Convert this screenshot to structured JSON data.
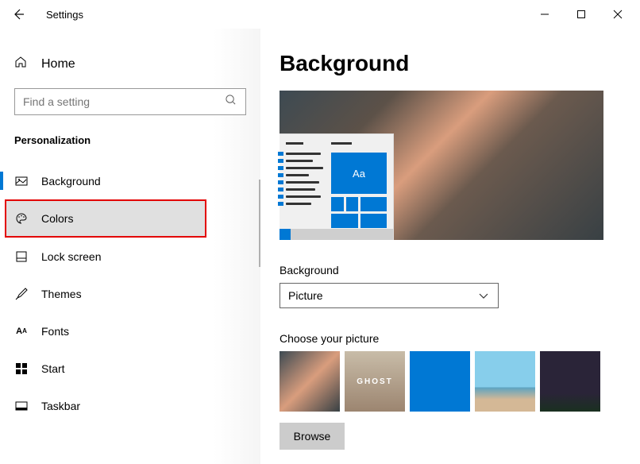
{
  "titlebar": {
    "app_title": "Settings"
  },
  "sidebar": {
    "home_label": "Home",
    "search_placeholder": "Find a setting",
    "section_label": "Personalization",
    "items": [
      {
        "label": "Background",
        "icon": "picture-icon"
      },
      {
        "label": "Colors",
        "icon": "palette-icon"
      },
      {
        "label": "Lock screen",
        "icon": "lockscreen-icon"
      },
      {
        "label": "Themes",
        "icon": "brush-icon"
      },
      {
        "label": "Fonts",
        "icon": "fonts-icon"
      },
      {
        "label": "Start",
        "icon": "start-icon"
      },
      {
        "label": "Taskbar",
        "icon": "taskbar-icon"
      }
    ]
  },
  "main": {
    "page_title": "Background",
    "preview_sample": "Aa",
    "bg_label": "Background",
    "bg_value": "Picture",
    "choose_label": "Choose your picture",
    "thumb_ghost": "GHOST",
    "browse_label": "Browse"
  }
}
